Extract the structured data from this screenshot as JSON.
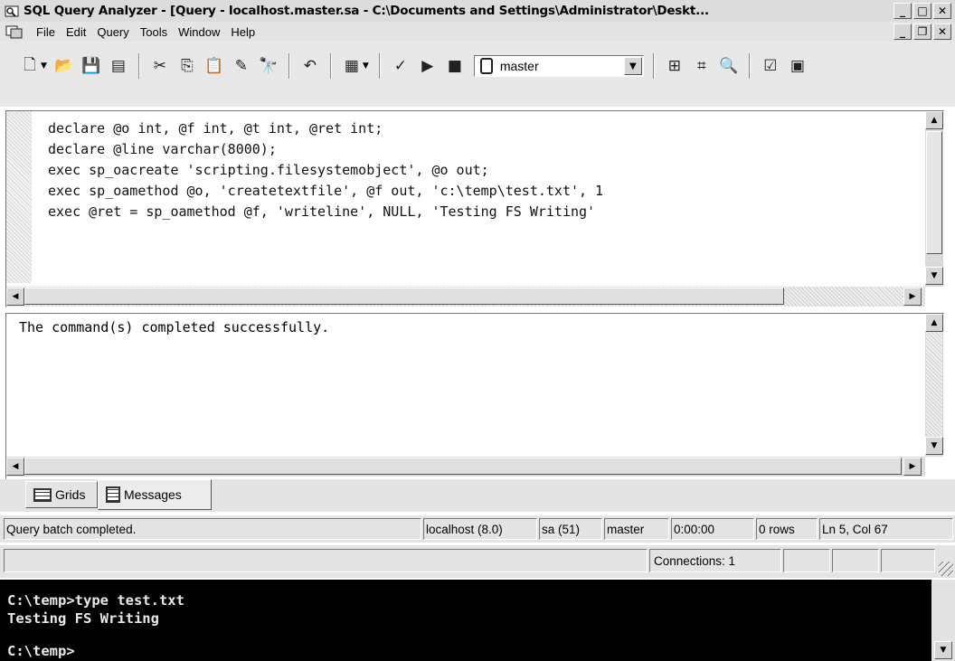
{
  "window": {
    "title": "SQL Query Analyzer - [Query - localhost.master.sa - C:\\Documents and Settings\\Administrator\\Deskt...",
    "caption_buttons": [
      "minimize",
      "maximize",
      "close"
    ]
  },
  "menubar": {
    "items": [
      "File",
      "Edit",
      "Query",
      "Tools",
      "Window",
      "Help"
    ],
    "doc_buttons": [
      "minimize",
      "restore",
      "close"
    ]
  },
  "toolbar": {
    "buttons": [
      "new-query-icon",
      "open-icon",
      "save-icon",
      "insert-template-icon",
      "cut-icon",
      "copy-icon",
      "paste-icon",
      "clear-window-icon",
      "find-icon",
      "undo-icon",
      "results-mode-icon",
      "parse-icon",
      "execute-icon",
      "cancel-icon",
      "object-browser-icon",
      "object-search-icon",
      "execution-plan-icon",
      "properties-icon",
      "show-results-icon"
    ],
    "database": "master"
  },
  "editor": {
    "lines": [
      "declare @o int, @f int, @t int, @ret int;",
      "declare @line varchar(8000);",
      "exec sp_oacreate 'scripting.filesystemobject', @o out;",
      "exec sp_oamethod @o, 'createtextfile', @f out, 'c:\\temp\\test.txt', 1",
      "exec @ret = sp_oamethod @f, 'writeline', NULL, 'Testing FS Writing'"
    ]
  },
  "results": {
    "message": "The command(s) completed successfully."
  },
  "tabs": [
    {
      "label": "Grids",
      "icon": "grid-icon"
    },
    {
      "label": "Messages",
      "icon": "messages-icon"
    }
  ],
  "status": {
    "message": "Query batch completed.",
    "server": "localhost (8.0)",
    "user": "sa (51)",
    "database": "master",
    "elapsed": "0:00:00",
    "rows": "0 rows",
    "position": "Ln 5, Col 67",
    "connections": "Connections: 1"
  },
  "console": {
    "lines": [
      "C:\\temp>type test.txt",
      "Testing FS Writing",
      "",
      "C:\\temp>"
    ]
  }
}
